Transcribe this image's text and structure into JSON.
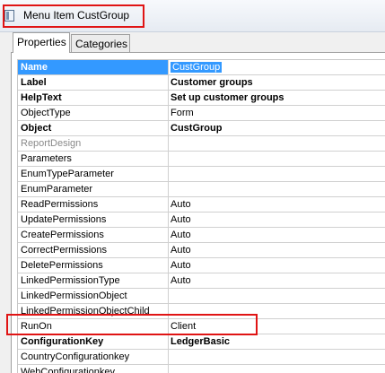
{
  "window": {
    "title": "Menu Item CustGroup"
  },
  "tabs": [
    {
      "label": "Properties",
      "active": true
    },
    {
      "label": "Categories",
      "active": false
    }
  ],
  "properties": [
    {
      "name": "Name",
      "value": "CustGroup"
    },
    {
      "name": "Label",
      "value": "Customer groups"
    },
    {
      "name": "HelpText",
      "value": "Set up customer groups"
    },
    {
      "name": "ObjectType",
      "value": "Form"
    },
    {
      "name": "Object",
      "value": "CustGroup"
    },
    {
      "name": "ReportDesign",
      "value": ""
    },
    {
      "name": "Parameters",
      "value": ""
    },
    {
      "name": "EnumTypeParameter",
      "value": ""
    },
    {
      "name": "EnumParameter",
      "value": ""
    },
    {
      "name": "ReadPermissions",
      "value": "Auto"
    },
    {
      "name": "UpdatePermissions",
      "value": "Auto"
    },
    {
      "name": "CreatePermissions",
      "value": "Auto"
    },
    {
      "name": "CorrectPermissions",
      "value": "Auto"
    },
    {
      "name": "DeletePermissions",
      "value": "Auto"
    },
    {
      "name": "LinkedPermissionType",
      "value": "Auto"
    },
    {
      "name": "LinkedPermissionObject",
      "value": ""
    },
    {
      "name": "LinkedPermissionObjectChild",
      "value": ""
    },
    {
      "name": "RunOn",
      "value": "Client"
    },
    {
      "name": "ConfigurationKey",
      "value": "LedgerBasic"
    },
    {
      "name": "CountryConfigurationkey",
      "value": ""
    },
    {
      "name": "WebConfigurationkey",
      "value": ""
    }
  ],
  "highlight_color": "#e01414",
  "selection_color": "#3399ff"
}
